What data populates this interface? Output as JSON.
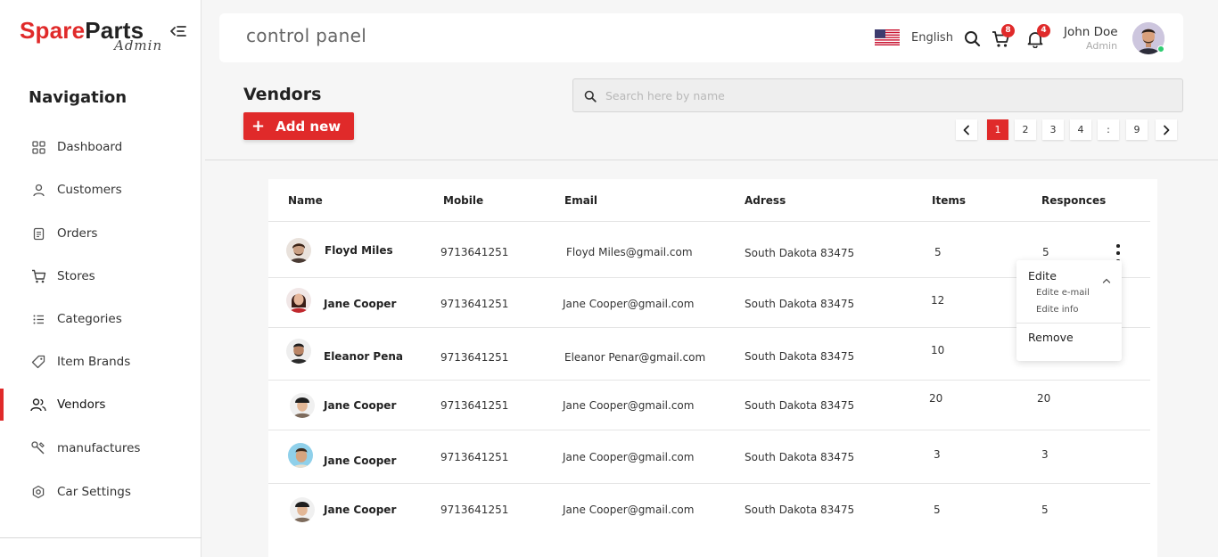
{
  "brand": {
    "name_part1": "Spare",
    "name_part2": "Parts",
    "subtitle": "Admin"
  },
  "sidebar": {
    "title": "Navigation",
    "items": [
      {
        "label": "Dashboard",
        "icon": "grid-icon"
      },
      {
        "label": "Customers",
        "icon": "user-icon"
      },
      {
        "label": "Orders",
        "icon": "document-icon"
      },
      {
        "label": "Stores",
        "icon": "cart-icon"
      },
      {
        "label": "Categories",
        "icon": "list-icon"
      },
      {
        "label": "Item Brands",
        "icon": "tag-icon"
      },
      {
        "label": "Vendors",
        "icon": "users-icon",
        "active": true
      },
      {
        "label": "manufactures",
        "icon": "tools-icon"
      },
      {
        "label": "Car Settings",
        "icon": "settings-icon"
      }
    ]
  },
  "header": {
    "title": "control panel",
    "language": "English",
    "cart_count": "8",
    "notification_count": "4",
    "user": {
      "name": "John Doe",
      "role": "Admin"
    }
  },
  "page": {
    "title": "Vendors",
    "add_button": "Add new",
    "add_icon": "+",
    "search_placeholder": "Search here by name"
  },
  "pagination": {
    "pages": [
      "1",
      "2",
      "3",
      "4",
      ":",
      "9"
    ],
    "current": "1"
  },
  "table": {
    "columns": [
      "Name",
      "Mobile",
      "Email",
      "Adress",
      "Items",
      "Responces"
    ],
    "rows": [
      {
        "name": "Floyd Miles",
        "mobile": "9713641251",
        "email": "Floyd Miles@gmail.com",
        "address": "South Dakota 83475",
        "items": "5",
        "responses": "5"
      },
      {
        "name": "Jane Cooper",
        "mobile": "9713641251",
        "email": "Jane Cooper@gmail.com",
        "address": "South Dakota 83475",
        "items": "12",
        "responses": ""
      },
      {
        "name": "Eleanor Pena",
        "mobile": "9713641251",
        "email": "Eleanor Penar@gmail.com",
        "address": "South Dakota 83475",
        "items": "10",
        "responses": ""
      },
      {
        "name": "Jane Cooper",
        "mobile": "9713641251",
        "email": "Jane Cooper@gmail.com",
        "address": "South Dakota 83475",
        "items": "20",
        "responses": "20"
      },
      {
        "name": "Jane Cooper",
        "mobile": "9713641251",
        "email": "Jane Cooper@gmail.com",
        "address": "South Dakota 83475",
        "items": "3",
        "responses": "3"
      },
      {
        "name": "Jane Cooper",
        "mobile": "9713641251",
        "email": "Jane Cooper@gmail.com",
        "address": "South Dakota 83475",
        "items": "5",
        "responses": "5"
      }
    ]
  },
  "row_menu": {
    "edit": "Edite",
    "edit_email": "Edite e-mail",
    "edit_info": "Edite  info",
    "remove": "Remove"
  },
  "colors": {
    "accent": "#e02a2a",
    "online": "#2ecc71"
  }
}
